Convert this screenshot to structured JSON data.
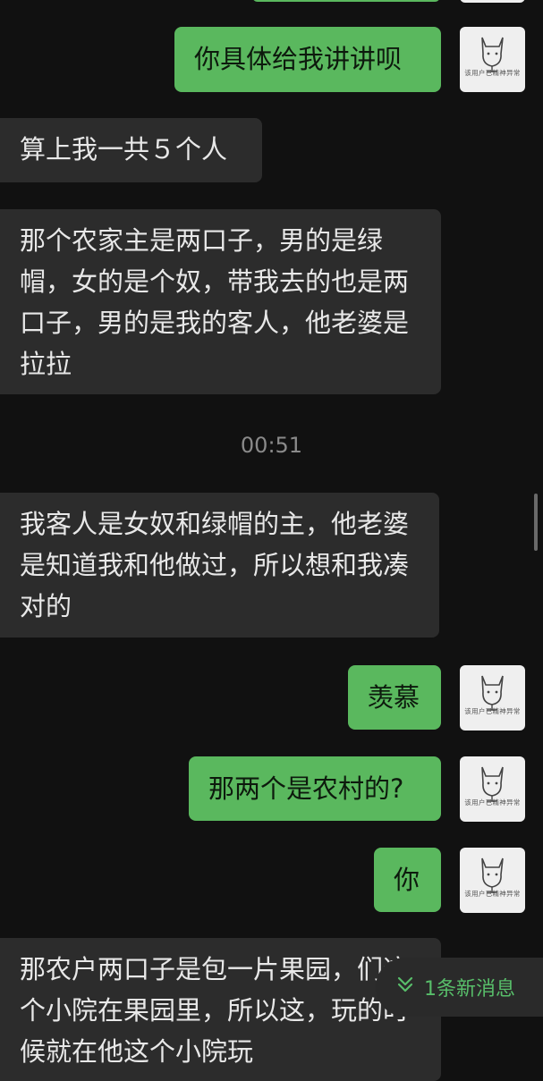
{
  "chat": {
    "messages": [
      {
        "side": "out",
        "text": "你具体给我讲讲呗"
      },
      {
        "side": "in",
        "text": "算上我一共５个人"
      },
      {
        "side": "in",
        "text": "那个农家主是两口子，男的是绿帽，女的是个奴，带我去的也是两口子，男的是我的客人，他老婆是拉拉"
      },
      {
        "side": "in",
        "text": "我客人是女奴和绿帽的主，他老婆是知道我和他做过，所以想和我凑对的"
      },
      {
        "side": "out",
        "text": "羡慕"
      },
      {
        "side": "out",
        "text": "那两个是农村的?"
      },
      {
        "side": "out",
        "text": "你"
      },
      {
        "side": "in",
        "text": "那农户两口子是包一片果园，们这个小院在果园里，所以这，玩的时候就在他这个小院玩"
      }
    ],
    "timestamp": "00:51",
    "new_message_badge": "1条新消息",
    "avatar_caption": "该用户已精神异常"
  },
  "colors": {
    "background": "#111111",
    "incoming_bubble": "#2c2c2c",
    "outgoing_bubble": "#5ab85e",
    "accent_green": "#58be6a"
  },
  "icons": {
    "avatar": "cat-avatar-icon",
    "new_message": "double-chevron-down-icon"
  }
}
